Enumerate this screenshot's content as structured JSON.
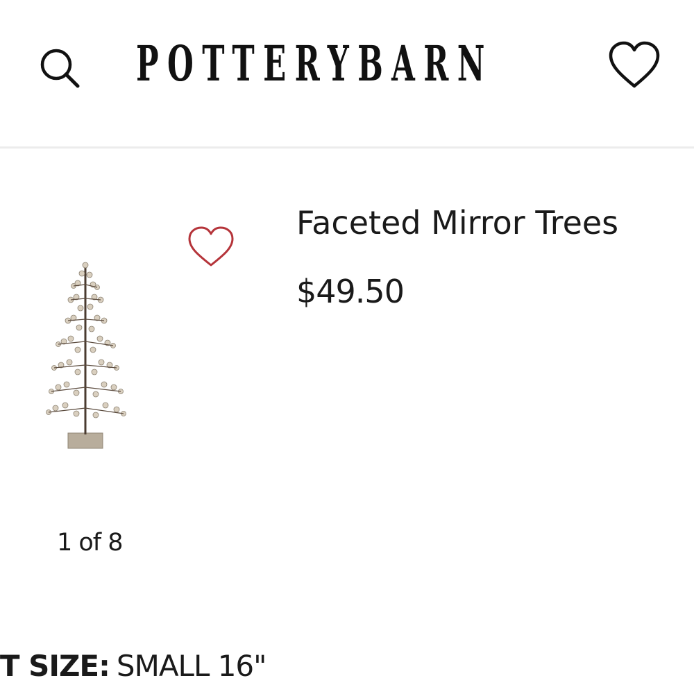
{
  "header": {
    "brand": "POTTERYBARN",
    "search_icon": "search-icon",
    "wishlist_icon": "heart-outline-icon"
  },
  "product": {
    "title": "Faceted Mirror Trees",
    "price": "$49.50",
    "image_counter": "1 of 8",
    "favorite_icon": "heart-outline-icon",
    "favorite_color": "#b5343a",
    "size_label": "CT SIZE:",
    "size_value": "SMALL 16\""
  }
}
